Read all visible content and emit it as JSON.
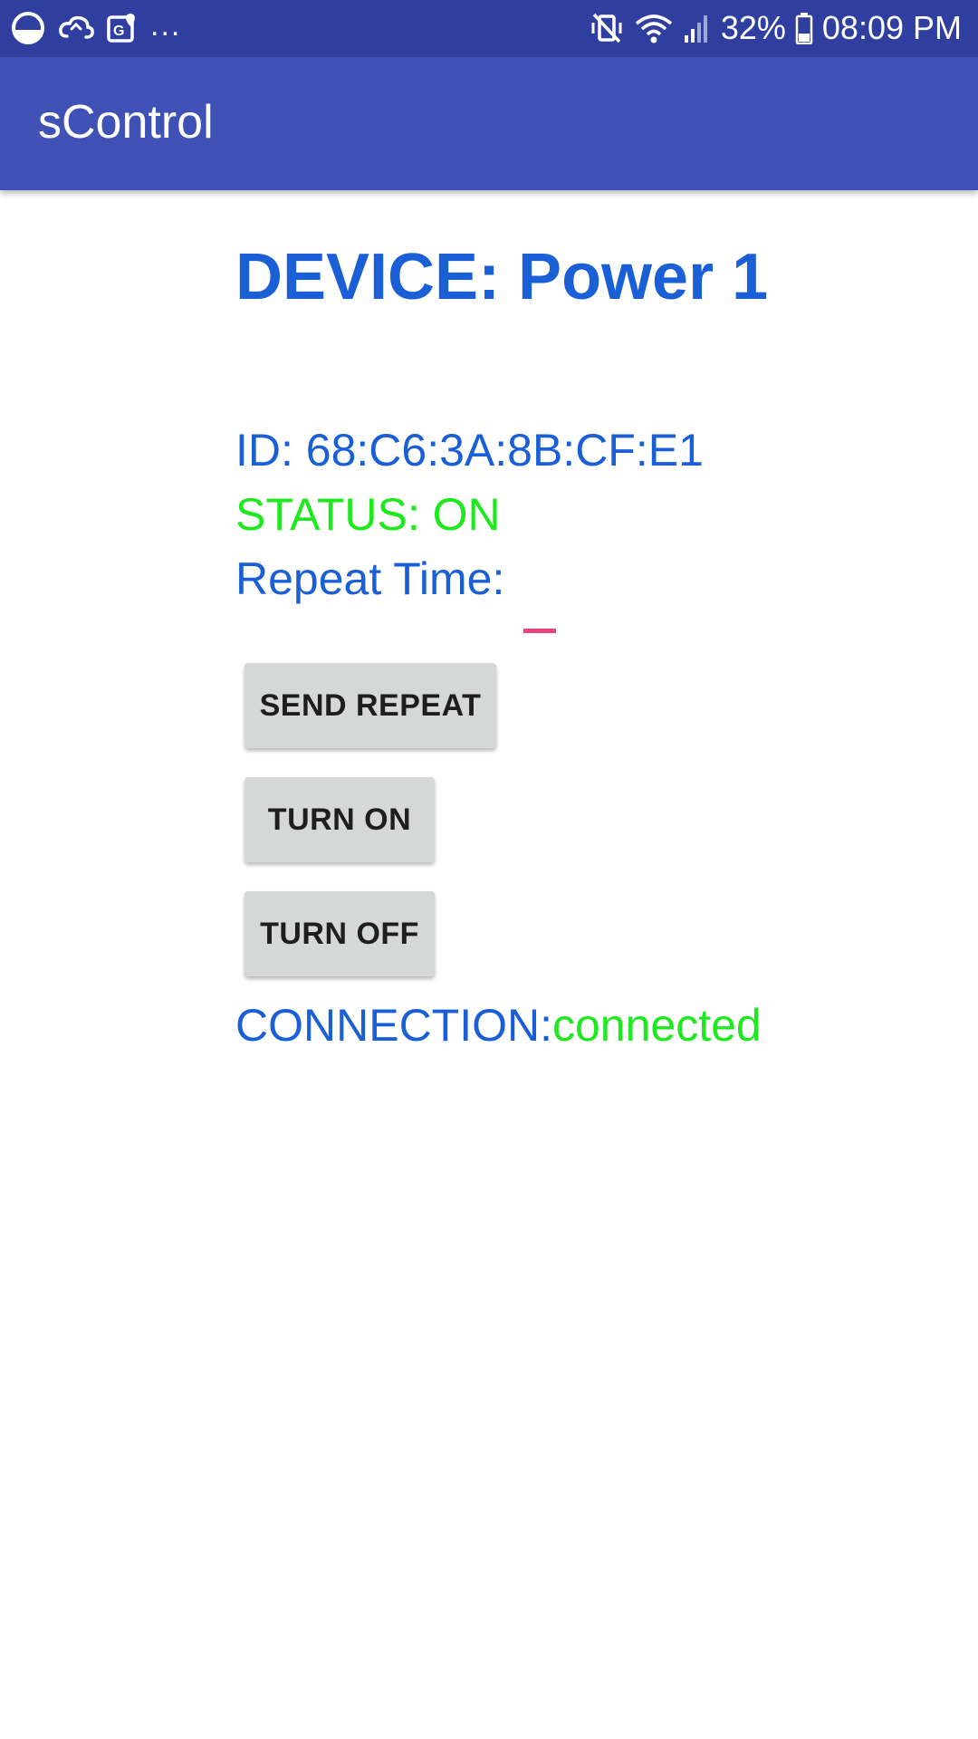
{
  "status_bar": {
    "left_icons": [
      "circle-half-icon",
      "cloud-sync-icon",
      "map-pin-icon"
    ],
    "overflow": "...",
    "right_icons": [
      "vibrate-mute-icon",
      "wifi-icon",
      "signal-icon",
      "battery-icon"
    ],
    "battery": "32%",
    "time": "08:09 PM"
  },
  "app_bar": {
    "title": "sControl"
  },
  "device": {
    "title": "DEVICE: Power 1",
    "id": "ID: 68:C6:3A:8B:CF:E1",
    "status": "STATUS: ON",
    "repeat_label": "Repeat Time:",
    "repeat_value": ""
  },
  "buttons": {
    "send_repeat": "SEND REPEAT",
    "turn_on": "TURN ON",
    "turn_off": "TURN OFF"
  },
  "connection": {
    "label": "CONNECTION:",
    "value": "connected"
  },
  "colors": {
    "status_bar": "#303f9f",
    "app_bar": "#3f51b5",
    "text_blue": "#1a5fd6",
    "text_green": "#1ee81e",
    "accent_pink": "#e8457a",
    "button_bg": "#d6d7d7"
  }
}
